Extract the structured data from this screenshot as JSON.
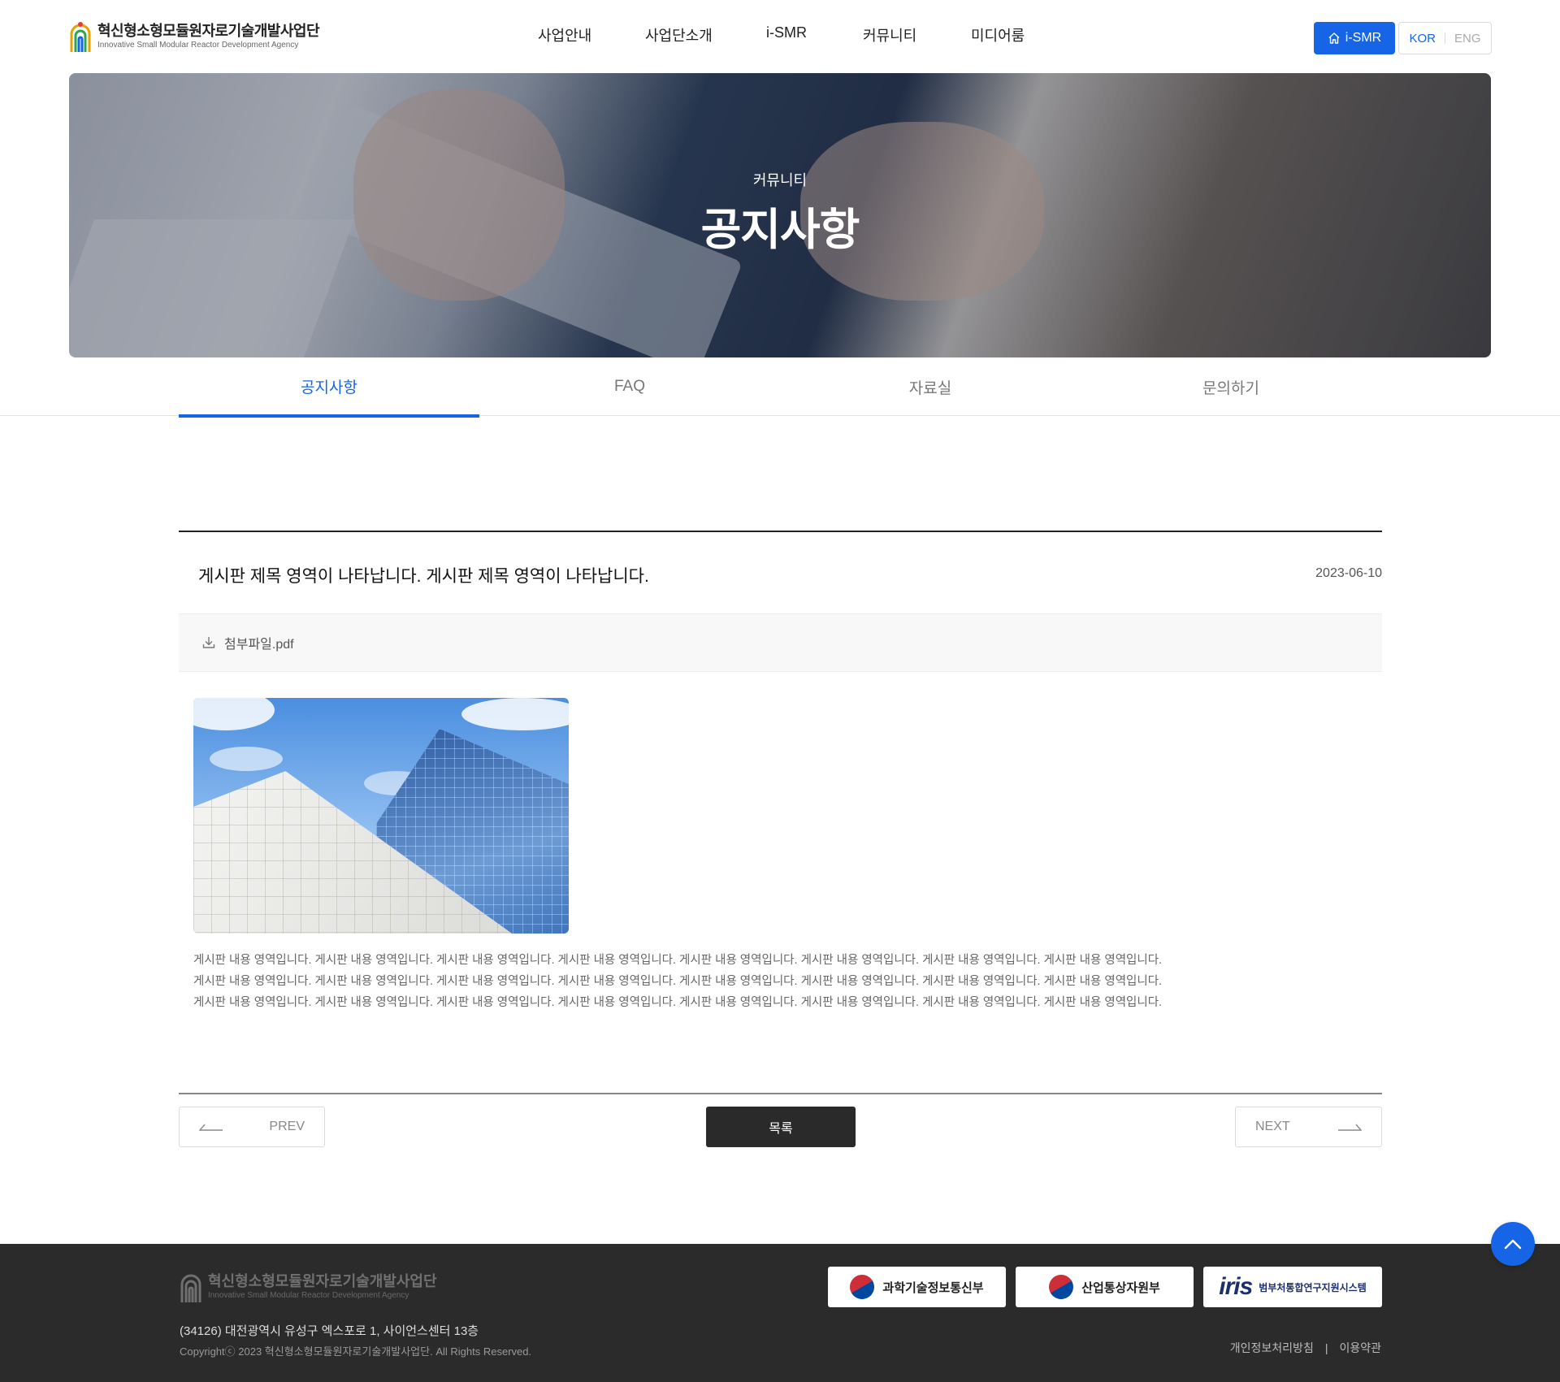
{
  "header": {
    "logo_ko": "혁신형소형모듈원자로기술개발사업단",
    "logo_en": "Innovative Small Modular Reactor Development Agency",
    "nav": [
      "사업안내",
      "사업단소개",
      "i-SMR",
      "커뮤니티",
      "미디어룸"
    ],
    "ismr_button": "i-SMR",
    "lang_kor": "KOR",
    "lang_eng": "ENG"
  },
  "visual": {
    "subtitle": "커뮤니티",
    "title": "공지사항"
  },
  "tabs": [
    {
      "label": "공지사항",
      "active": true
    },
    {
      "label": "FAQ",
      "active": false
    },
    {
      "label": "자료실",
      "active": false
    },
    {
      "label": "문의하기",
      "active": false
    }
  ],
  "article": {
    "title": "게시판 제목 영역이 나타납니다. 게시판 제목 영역이 나타납니다.",
    "date": "2023-06-10",
    "attachment": "첨부파일.pdf",
    "body_lines": [
      "게시판 내용 영역입니다. 게시판 내용 영역입니다. 게시판 내용 영역입니다. 게시판 내용 영역입니다. 게시판 내용 영역입니다. 게시판 내용 영역입니다. 게시판 내용 영역입니다. 게시판 내용 영역입니다.",
      "게시판 내용 영역입니다. 게시판 내용 영역입니다. 게시판 내용 영역입니다. 게시판 내용 영역입니다. 게시판 내용 영역입니다. 게시판 내용 영역입니다. 게시판 내용 영역입니다. 게시판 내용 영역입니다.",
      "게시판 내용 영역입니다. 게시판 내용 영역입니다. 게시판 내용 영역입니다. 게시판 내용 영역입니다. 게시판 내용 영역입니다. 게시판 내용 영역입니다. 게시판 내용 영역입니다. 게시판 내용 영역입니다."
    ]
  },
  "pager": {
    "prev": "PREV",
    "list": "목록",
    "next": "NEXT"
  },
  "footer": {
    "logo_ko": "혁신형소형모듈원자로기술개발사업단",
    "logo_en": "Innovative Small Modular Reactor Development Agency",
    "address": "(34126) 대전광역시 유성구 엑스포로 1, 사이언스센터 13층",
    "copyright": "Copyrightⓒ 2023 혁신형소형모듈원자로기술개발사업단. All Rights Reserved.",
    "banners": [
      "과학기술정보통신부",
      "산업통상자원부"
    ],
    "iris_logo": "iris",
    "iris_sub": "범부처통합연구지원시스템",
    "privacy": "개인정보처리방침",
    "terms": "이용약관",
    "divider": "|"
  },
  "colors": {
    "accent": "#1565e6",
    "footer_bg": "#2b2b2b",
    "list_button": "#2a2a2a"
  }
}
